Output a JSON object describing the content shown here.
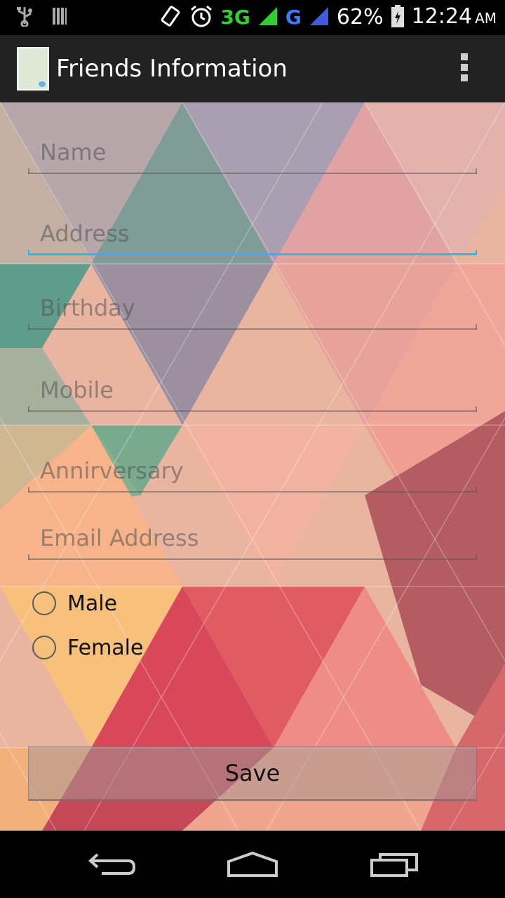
{
  "status_bar": {
    "network_3g": "3G",
    "network_g": "G",
    "battery": "62%",
    "time": "12:24",
    "ampm": "AM",
    "icons": [
      "usb-icon",
      "storage-icon",
      "rotate-icon",
      "alarm-icon",
      "signal-icon",
      "battery-icon"
    ]
  },
  "action_bar": {
    "title": "Friends Information",
    "icon": "app-notebook-icon"
  },
  "form": {
    "name_placeholder": "Name",
    "address_placeholder": "Address",
    "birthday_placeholder": "Birthday",
    "mobile_placeholder": "Mobile",
    "anniversary_placeholder": "Annirversary",
    "email_placeholder": "Email Address",
    "gender_male": "Male",
    "gender_female": "Female",
    "save_label": "Save"
  },
  "colors": {
    "focus_accent": "#33b5e5",
    "action_bar_bg": "#222222"
  },
  "nav_bar": {
    "icons": [
      "back-icon",
      "home-icon",
      "recent-apps-icon"
    ]
  }
}
